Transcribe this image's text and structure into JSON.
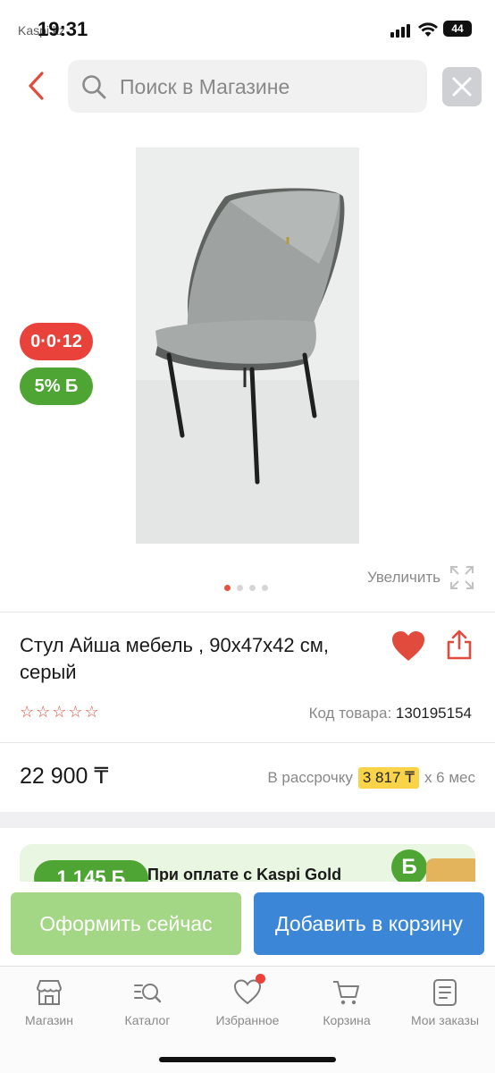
{
  "status_bar": {
    "time": "19:31",
    "back_app": "Kaspi.kz",
    "battery": "44"
  },
  "header": {
    "search_placeholder": "Поиск в Магазине"
  },
  "badges": {
    "installment": "0·0·12",
    "bonus": "5% Б"
  },
  "gallery": {
    "zoom_label": "Увеличить",
    "image_count": 4,
    "active_index": 0
  },
  "product": {
    "title": "Стул Айша мебель , 90x47x42 см, серый",
    "rating": 0,
    "sku_label": "Код товара:",
    "sku_value": "130195154",
    "price": "22 900 ₸",
    "credit_prefix": "В рассрочку",
    "credit_amount": "3 817 ₸",
    "credit_suffix": "x 6 мес"
  },
  "promo": {
    "bonus": "1 145 Б",
    "text": "При оплате с Kaspi Gold",
    "coin": "Б"
  },
  "actions": {
    "checkout": "Оформить сейчас",
    "add_to_cart": "Добавить в корзину"
  },
  "tabs": [
    {
      "label": "Магазин",
      "icon": "shop-icon"
    },
    {
      "label": "Каталог",
      "icon": "catalog-search-icon"
    },
    {
      "label": "Избранное",
      "icon": "heart-icon"
    },
    {
      "label": "Корзина",
      "icon": "cart-icon"
    },
    {
      "label": "Мои заказы",
      "icon": "orders-icon"
    }
  ],
  "colors": {
    "accent_red": "#e8423b",
    "green": "#4fa534",
    "blue": "#3b86d6",
    "light_green": "#a4d785",
    "yellow": "#f9d449"
  }
}
